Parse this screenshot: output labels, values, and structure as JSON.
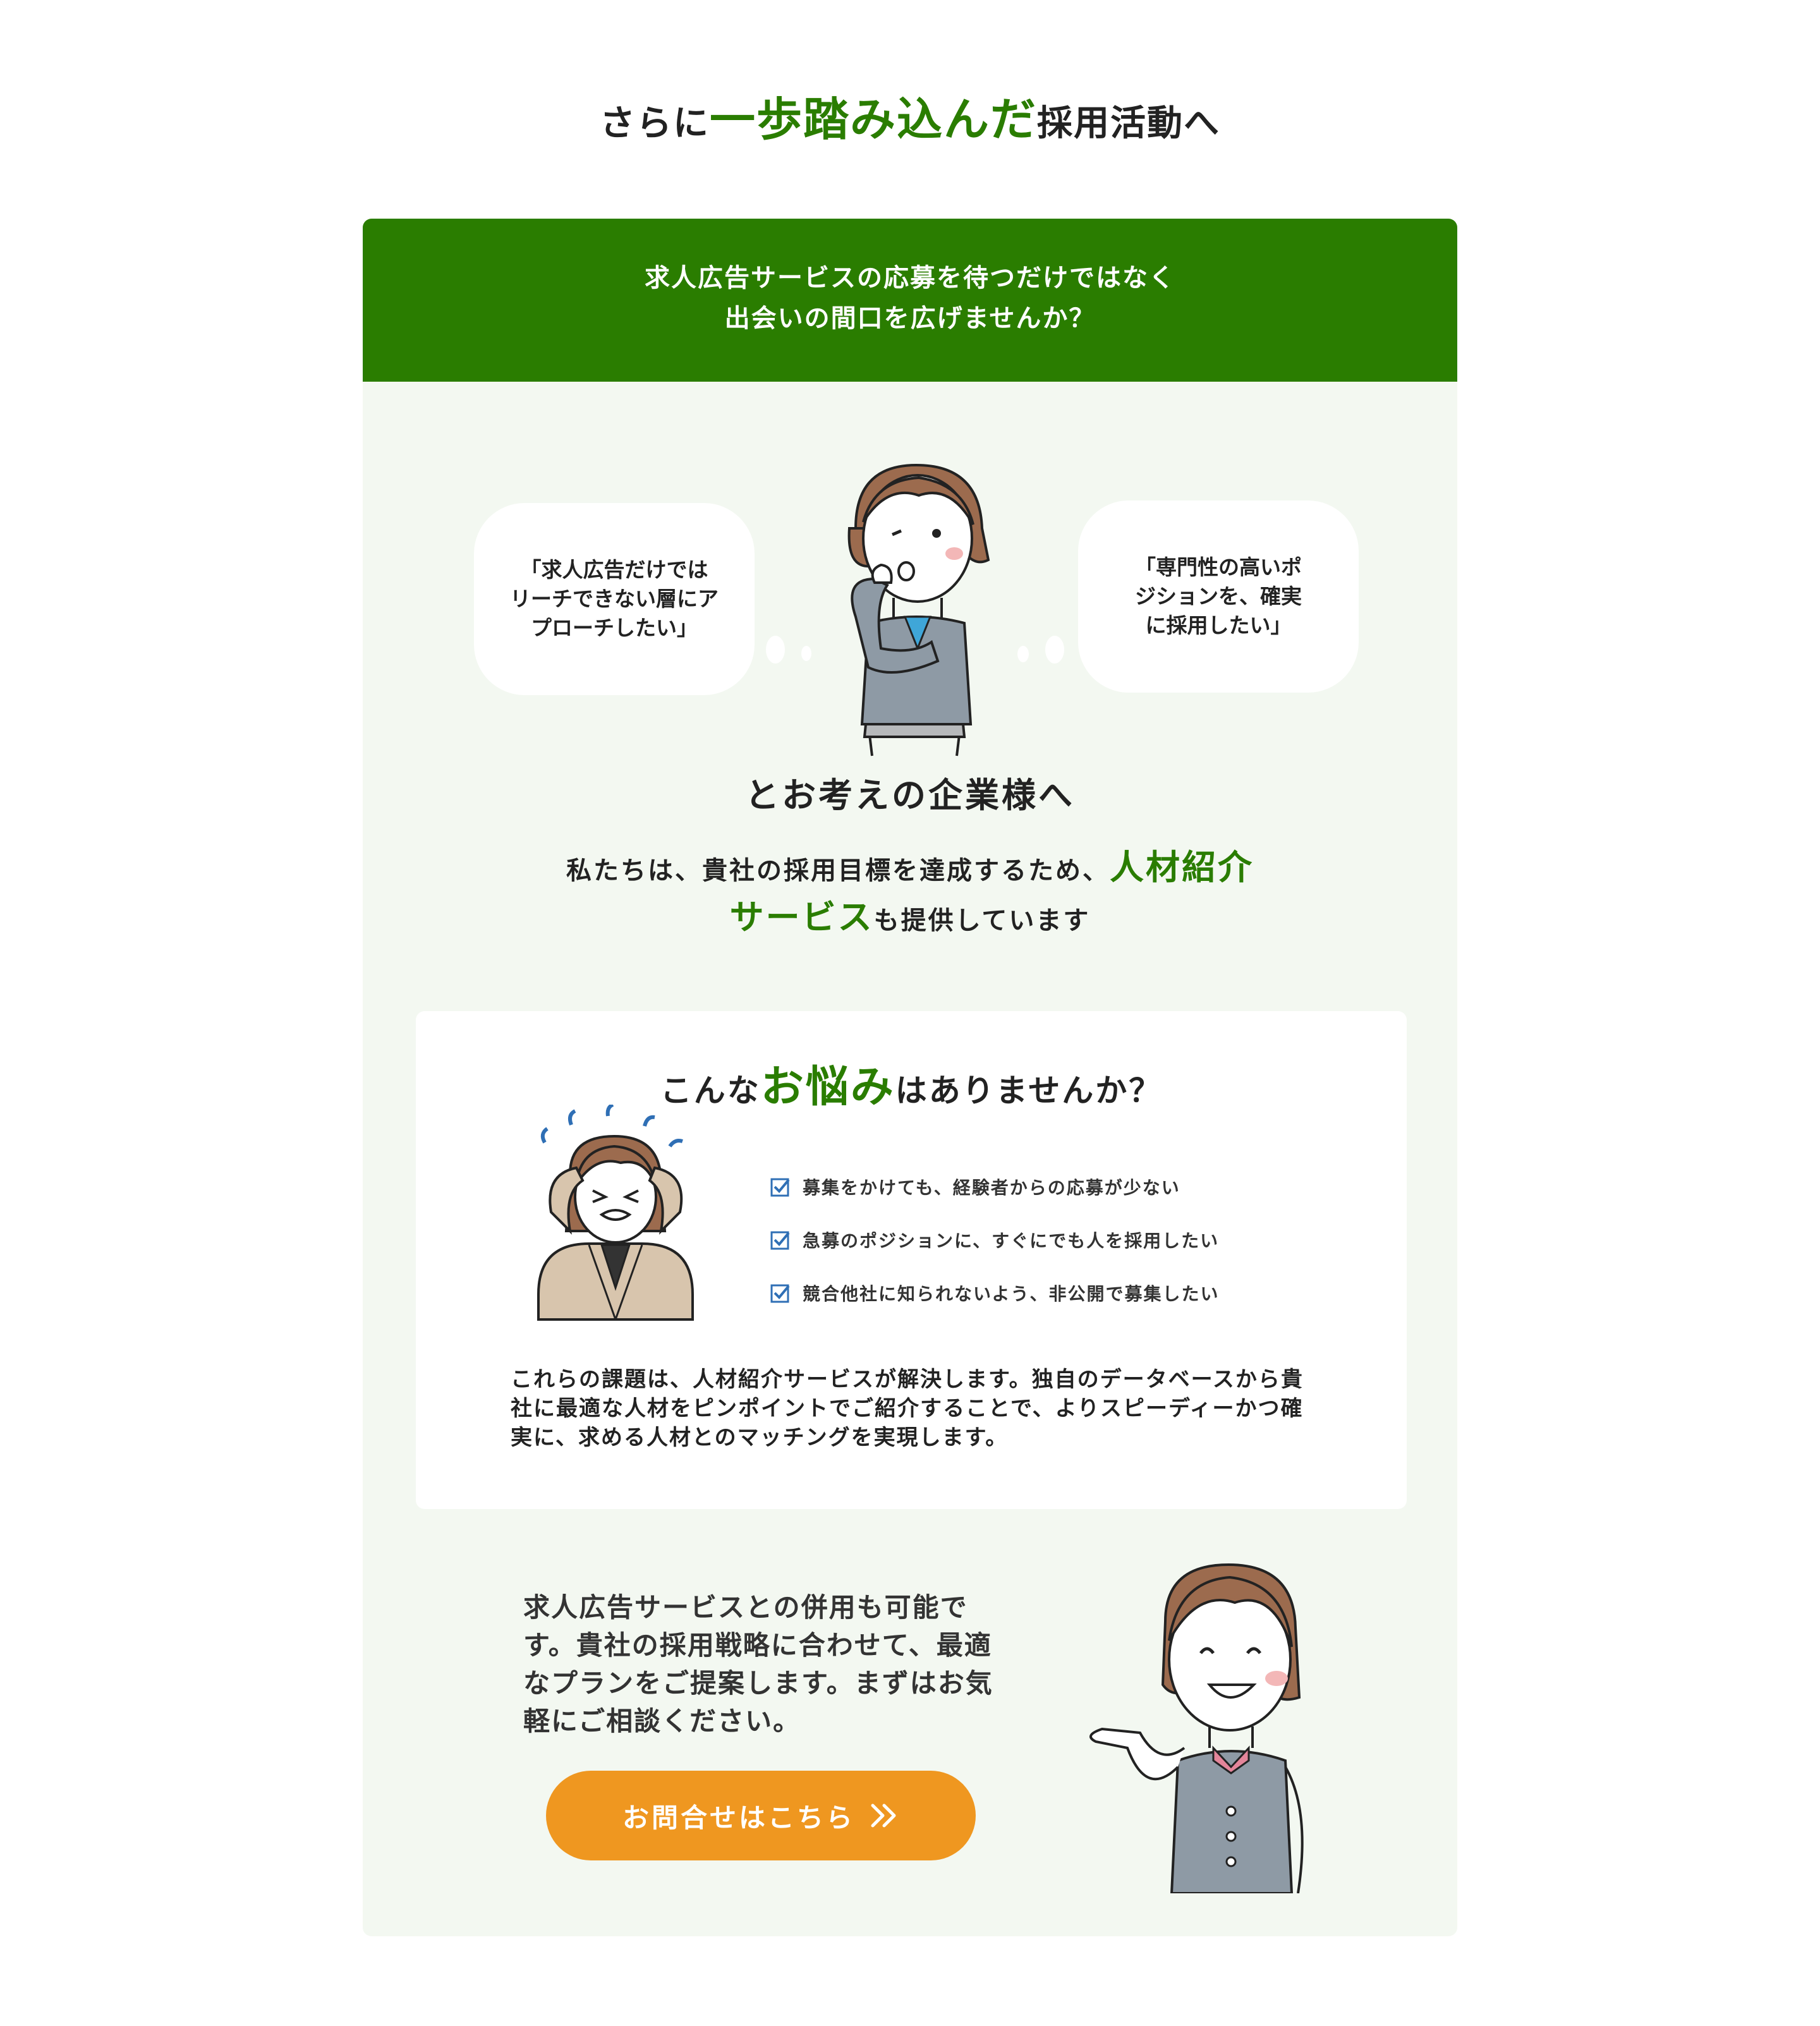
{
  "headline": {
    "prefix": "さらに",
    "accent": "一歩踏み込んだ",
    "suffix": "採用活動へ"
  },
  "panel_header": {
    "line1": "求人広告サービスの応募を待つだけではなく",
    "line2": "出会いの間口を広げませんか？"
  },
  "bubbles": {
    "left": {
      "line1": "「求人広告だけでは",
      "line2": "リーチできない層にア",
      "line3": "プローチしたい」"
    },
    "right": {
      "line1": "「専門性の高いポ",
      "line2": "ジションを、確実",
      "line3": "に採用したい」"
    }
  },
  "consider": "とお考えの企業様へ",
  "intro": {
    "part1": "私たちは、貴社の採用目標を達成するため、",
    "accent1": "人材紹介",
    "accent2": "サービス",
    "part2": "も提供しています"
  },
  "trouble": {
    "title_prefix": "こんな",
    "title_accent": "お悩み",
    "title_suffix": "はありませんか？",
    "items": [
      "募集をかけても、経験者からの応募が少ない",
      "急募のポジションに、すぐにでも人を採用したい",
      "競合他社に知られないよう、非公開で募集したい"
    ],
    "solution": "これらの課題は、人材紹介サービスが解決します。独自のデータベースから貴社に最適な人材をピンポイントでご紹介することで、よりスピーディーかつ確実に、求める人材とのマッチングを実現します。"
  },
  "combo_text": "求人広告サービスとの併用も可能です。貴社の採用戦略に合わせて、最適なプランをご提案します。まずはお気軽にご相談ください。",
  "cta": {
    "label": "お問合せはこちら"
  },
  "colors": {
    "accent_green": "#2a7d00",
    "panel_bg": "#f3f8f1",
    "cta_orange": "#ef9720",
    "check_blue": "#2f6fb5"
  },
  "icons": {
    "check": "checkbox-checked-icon",
    "cta_arrow": "double-chevron-right-icon"
  }
}
